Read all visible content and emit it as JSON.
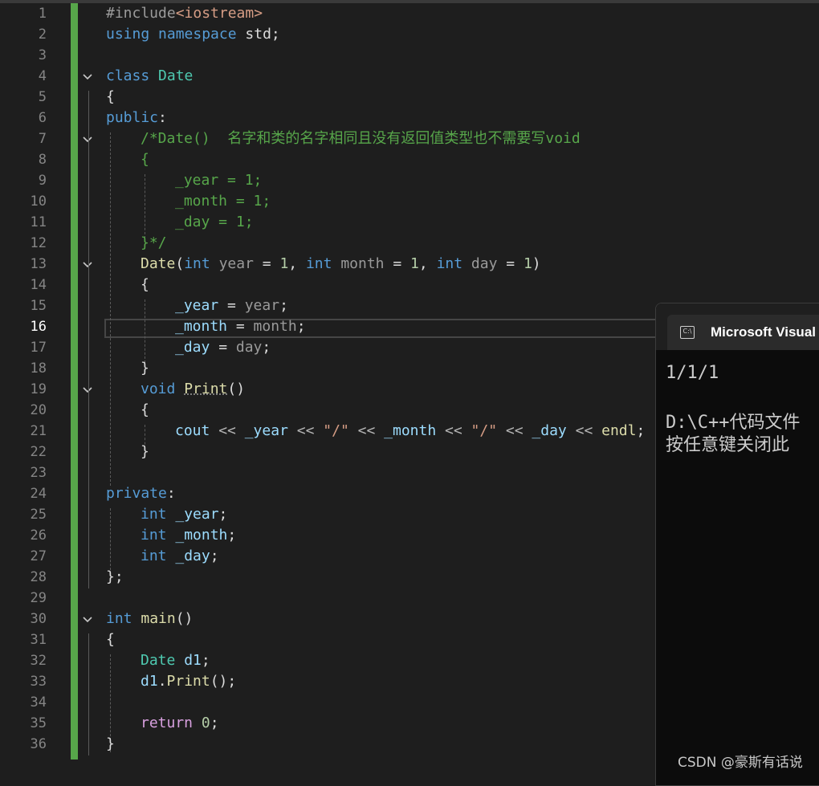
{
  "editor": {
    "current_line": 16,
    "line_numbers": [
      "1",
      "2",
      "3",
      "4",
      "5",
      "6",
      "7",
      "8",
      "9",
      "10",
      "11",
      "12",
      "13",
      "14",
      "15",
      "16",
      "17",
      "18",
      "19",
      "20",
      "21",
      "22",
      "23",
      "24",
      "25",
      "26",
      "27",
      "28",
      "29",
      "30",
      "31",
      "32",
      "33",
      "34",
      "35",
      "36"
    ],
    "fold_lines": [
      4,
      7,
      13,
      19,
      30
    ],
    "tokens": {
      "include_directive": "#include",
      "include_header": "<iostream>",
      "kw_using": "using",
      "kw_namespace": "namespace",
      "std_semicolon": " std;",
      "kw_class": "class",
      "type_date": "Date",
      "brace_open": "{",
      "brace_close": "}",
      "kw_public": "public",
      "colon": ":",
      "comment_line7": "/*Date()  名字和类的名字相同且没有返回值类型也不需要写void",
      "comment_brace_open": "{",
      "comment_year": "_year = 1;",
      "comment_month": "_month = 1;",
      "comment_day": "_day = 1;",
      "comment_close": "}*/",
      "fn_date": "Date",
      "paren_open": "(",
      "paren_close": ")",
      "kw_int": "int",
      "param_year": "year",
      "param_month": "month",
      "param_day": "day",
      "eq": " = ",
      "num_1": "1",
      "comma": ", ",
      "member_year": "_year",
      "member_month": "_month",
      "member_day": "_day",
      "semicolon": ";",
      "kw_void": "void",
      "fn_print": "Print",
      "empty_parens": "()",
      "cout": "cout",
      "shift": " << ",
      "str_slash": "\"/\"",
      "endl": "endl",
      "kw_private": "private",
      "close_class": "};",
      "fn_main": "main",
      "var_d1": "d1",
      "dot": ".",
      "kw_return": "return",
      "num_0": "0"
    }
  },
  "console": {
    "title": "Microsoft Visual",
    "icon": "console-icon",
    "icon_text": "C:\\",
    "output_line1": "1/1/1",
    "output_line2": "D:\\C++代码文件",
    "output_line3": "按任意键关闭此"
  },
  "watermark": "CSDN @豪斯有话说"
}
